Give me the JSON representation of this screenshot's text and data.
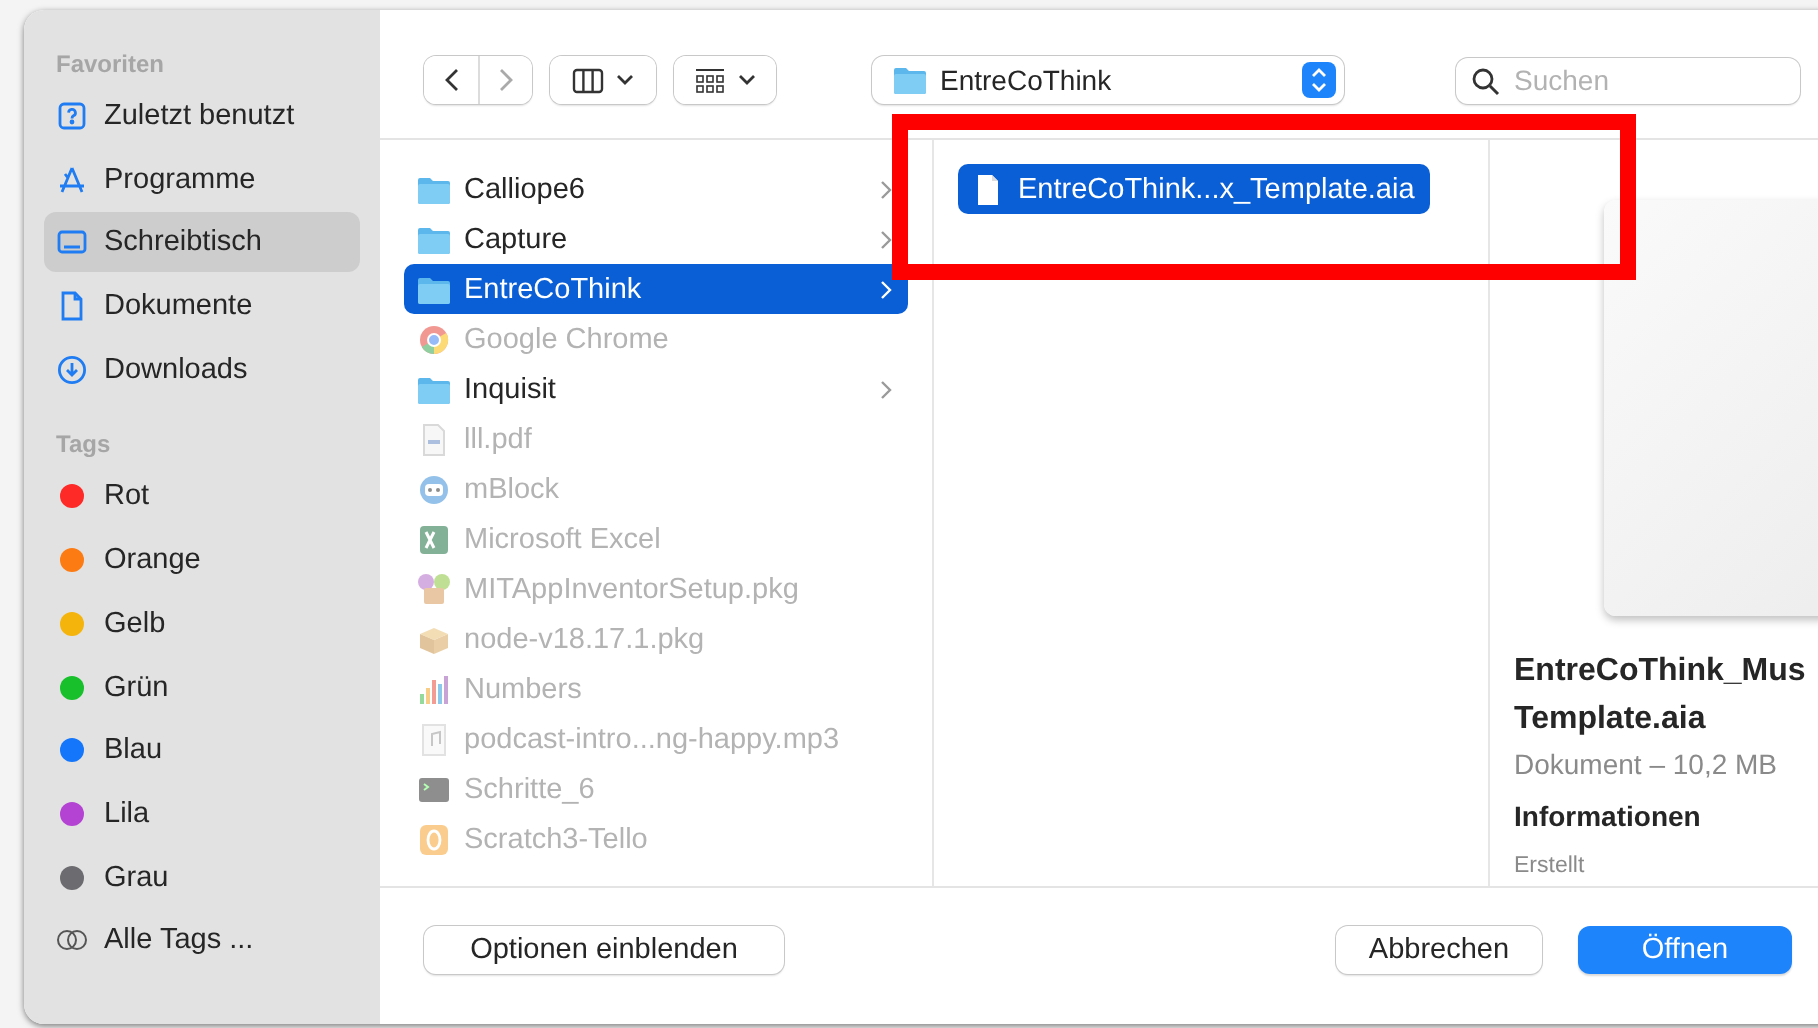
{
  "sidebar": {
    "favorites_title": "Favoriten",
    "favorites": [
      {
        "label": "Zuletzt benutzt",
        "kind": "recent",
        "selected": false
      },
      {
        "label": "Programme",
        "kind": "apps",
        "selected": false
      },
      {
        "label": "Schreibtisch",
        "kind": "desktop",
        "selected": true
      },
      {
        "label": "Dokumente",
        "kind": "document",
        "selected": false
      },
      {
        "label": "Downloads",
        "kind": "download",
        "selected": false
      }
    ],
    "tags_title": "Tags",
    "tags": [
      {
        "label": "Rot",
        "color": "#fe2a28"
      },
      {
        "label": "Orange",
        "color": "#fd7b13"
      },
      {
        "label": "Gelb",
        "color": "#f5b40c"
      },
      {
        "label": "Grün",
        "color": "#18c12c"
      },
      {
        "label": "Blau",
        "color": "#1477fb"
      },
      {
        "label": "Lila",
        "color": "#b443d3"
      },
      {
        "label": "Grau",
        "color": "#6c6c70"
      }
    ],
    "all_tags": "Alle Tags ..."
  },
  "toolbar": {
    "path": "EntreCoThink",
    "search": {
      "placeholder": "Suchen"
    }
  },
  "column_1": [
    {
      "name": "Calliope6",
      "kind": "folder",
      "disabled": false,
      "selected": false,
      "has_children": true
    },
    {
      "name": "Capture",
      "kind": "folder",
      "disabled": false,
      "selected": false,
      "has_children": true
    },
    {
      "name": "EntreCoThink",
      "kind": "folder",
      "disabled": false,
      "selected": true,
      "has_children": true
    },
    {
      "name": "Google Chrome",
      "kind": "chrome",
      "disabled": true,
      "selected": false,
      "has_children": false
    },
    {
      "name": "Inquisit",
      "kind": "folder",
      "disabled": false,
      "selected": false,
      "has_children": true
    },
    {
      "name": "lll.pdf",
      "kind": "pdf",
      "disabled": true,
      "selected": false,
      "has_children": false
    },
    {
      "name": "mBlock",
      "kind": "mblock",
      "disabled": true,
      "selected": false,
      "has_children": false
    },
    {
      "name": "Microsoft Excel",
      "kind": "excel",
      "disabled": true,
      "selected": false,
      "has_children": false
    },
    {
      "name": "MITAppInventorSetup.pkg",
      "kind": "mitapp",
      "disabled": true,
      "selected": false,
      "has_children": false
    },
    {
      "name": "node-v18.17.1.pkg",
      "kind": "package",
      "disabled": true,
      "selected": false,
      "has_children": false
    },
    {
      "name": "Numbers",
      "kind": "numbers",
      "disabled": true,
      "selected": false,
      "has_children": false
    },
    {
      "name": "podcast-intro...ng-happy.mp3",
      "kind": "audio",
      "disabled": true,
      "selected": false,
      "has_children": false
    },
    {
      "name": "Schritte_6",
      "kind": "terminal",
      "disabled": true,
      "selected": false,
      "has_children": false
    },
    {
      "name": "Scratch3-Tello",
      "kind": "scratch",
      "disabled": true,
      "selected": false,
      "has_children": false
    }
  ],
  "column_2": [
    {
      "name": "EntreCoThink...x_Template.aia",
      "kind": "file",
      "disabled": false,
      "selected": true,
      "has_children": false
    }
  ],
  "preview": {
    "title_lines": [
      "EntreCoThink_Mus",
      "Template.aia"
    ],
    "subtitle": "Dokument – 10,2 MB",
    "section": "Informationen",
    "field_label": "Erstellt"
  },
  "buttons": [
    {
      "label": "Optionen einblenden",
      "kind": "secondary"
    },
    {
      "label": "Abbrechen",
      "kind": "secondary"
    },
    {
      "label": "Öffnen",
      "kind": "primary"
    }
  ],
  "annotations": [
    {
      "kind": "rectangle"
    }
  ]
}
